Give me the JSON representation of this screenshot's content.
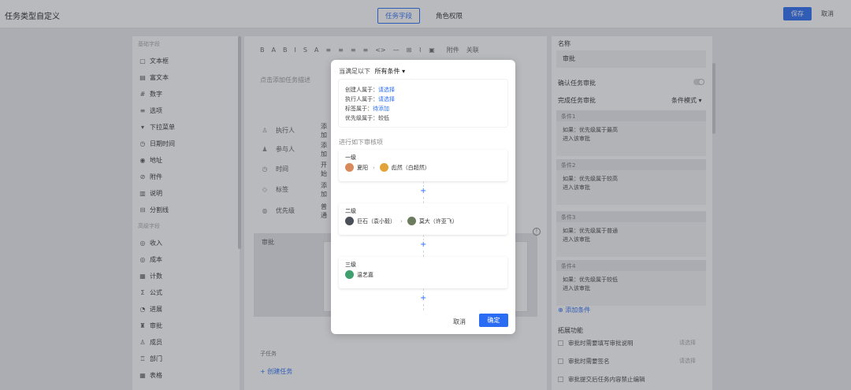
{
  "app_title": "任务类型自定义",
  "tabs": [
    {
      "label": "任务字段",
      "active": true
    },
    {
      "label": "角色权限",
      "active": false
    }
  ],
  "top_actions": {
    "save": "保存",
    "cancel": "取消"
  },
  "colors": {
    "accent": "#2a6df4",
    "overlay": "rgba(60,64,72,0.36)"
  },
  "left_panel": {
    "basic_group": "基础字段",
    "basic_items": [
      {
        "icon": "text-box-icon",
        "glyph": "▢",
        "label": "文本框"
      },
      {
        "icon": "rich-text-icon",
        "glyph": "▤",
        "label": "富文本"
      },
      {
        "icon": "number-icon",
        "glyph": "#",
        "label": "数字"
      },
      {
        "icon": "options-icon",
        "glyph": "≡",
        "label": "选项"
      },
      {
        "icon": "dropdown-icon",
        "glyph": "▾",
        "label": "下拉菜单"
      },
      {
        "icon": "datetime-icon",
        "glyph": "◷",
        "label": "日期时间"
      },
      {
        "icon": "location-icon",
        "glyph": "◉",
        "label": "地址"
      },
      {
        "icon": "attachment-icon",
        "glyph": "⊘",
        "label": "附件"
      },
      {
        "icon": "description-icon",
        "glyph": "▥",
        "label": "说明"
      },
      {
        "icon": "divider-icon",
        "glyph": "⊟",
        "label": "分割线"
      }
    ],
    "advanced_group": "高级字段",
    "advanced_items": [
      {
        "icon": "income-icon",
        "glyph": "◎",
        "label": "收入"
      },
      {
        "icon": "cost-icon",
        "glyph": "◎",
        "label": "成本"
      },
      {
        "icon": "count-icon",
        "glyph": "▦",
        "label": "计数"
      },
      {
        "icon": "formula-icon",
        "glyph": "Σ",
        "label": "公式"
      },
      {
        "icon": "progress-icon",
        "glyph": "◔",
        "label": "进展"
      },
      {
        "icon": "approval-icon",
        "glyph": "♜",
        "label": "审批"
      },
      {
        "icon": "member-icon",
        "glyph": "♙",
        "label": "成员"
      },
      {
        "icon": "department-icon",
        "glyph": "♖",
        "label": "部门"
      },
      {
        "icon": "table-icon",
        "glyph": "▦",
        "label": "表格"
      }
    ]
  },
  "editor": {
    "toolbar": {
      "icons": [
        "B",
        "A",
        "B",
        "I",
        "S",
        "A",
        "≡",
        "≡",
        "≡",
        "≡",
        "<>",
        "—",
        "⊞",
        "⌇",
        "▣"
      ],
      "attachment": "附件",
      "link": "关联"
    },
    "placeholder": "点击添加任务描述",
    "properties": [
      {
        "icon": "person-icon",
        "glyph": "♙",
        "label": "执行人",
        "value": "添加"
      },
      {
        "icon": "participants-icon",
        "glyph": "♟",
        "label": "参与人",
        "value": "添加"
      },
      {
        "icon": "clock-icon",
        "glyph": "◷",
        "label": "时间",
        "value": "开始"
      },
      {
        "icon": "tag-icon",
        "glyph": "◇",
        "label": "标签",
        "value": "添加"
      },
      {
        "icon": "priority-icon",
        "glyph": "◍",
        "label": "优先级",
        "value": "普通"
      }
    ],
    "approval_label": "审批",
    "subtask_label": "子任务",
    "create_task": "+ 创建任务"
  },
  "right_panel": {
    "name_label": "名称",
    "name_value": "审批",
    "confirm_approval": "确认任务审批",
    "confirm_toggle": false,
    "finish_approval": "完成任务审批",
    "condition_mode": "条件模式",
    "conditions": [
      {
        "title": "条件1",
        "line1": "如果：优先级属于最高",
        "line2": "进入该审批"
      },
      {
        "title": "条件2",
        "line1": "如果：优先级属于较高",
        "line2": "进入该审批"
      },
      {
        "title": "条件3",
        "line1": "如果：优先级属于普通",
        "line2": "进入该审批"
      },
      {
        "title": "条件4",
        "line1": "如果：优先级属于较低",
        "line2": "进入该审批"
      }
    ],
    "add_condition": "添加条件",
    "ext_title": "拓展功能",
    "ext_items": [
      {
        "label": "审批时需要填写审批说明",
        "value": "请选择"
      },
      {
        "label": "审批时需要签名",
        "value": "请选择"
      },
      {
        "label": "审批提交后任务内容禁止编辑",
        "value": ""
      }
    ]
  },
  "modal": {
    "cond_prefix": "当满足以下",
    "cond_dropdown": "所有条件",
    "conditions": [
      {
        "label": "创建人属于：",
        "value": "请选择",
        "is_link": true
      },
      {
        "label": "执行人属于：",
        "value": "请选择",
        "is_link": true
      },
      {
        "label": "标签属于：",
        "value": "待添加",
        "is_link": true
      },
      {
        "label": "优先级属于：",
        "value": "较低",
        "is_link": false
      }
    ],
    "section_title": "进行如下审核项",
    "levels": [
      {
        "title": "一级",
        "people": [
          {
            "name": "夏阳",
            "avatar_color": "#d98a5b"
          },
          {
            "name": "彪然（白超然）",
            "avatar_color": "#e2a33b"
          }
        ]
      },
      {
        "title": "二级",
        "people": [
          {
            "name": "巨石（袁小毅）",
            "avatar_color": "#4b4f57"
          },
          {
            "name": "莫大（许亚飞）",
            "avatar_color": "#6c7a5e"
          }
        ]
      },
      {
        "title": "三级",
        "people": [
          {
            "name": "温艺嘉",
            "avatar_color": "#3f9f6d"
          }
        ]
      }
    ],
    "add_symbol": "+",
    "cancel": "取消",
    "confirm": "确定"
  }
}
